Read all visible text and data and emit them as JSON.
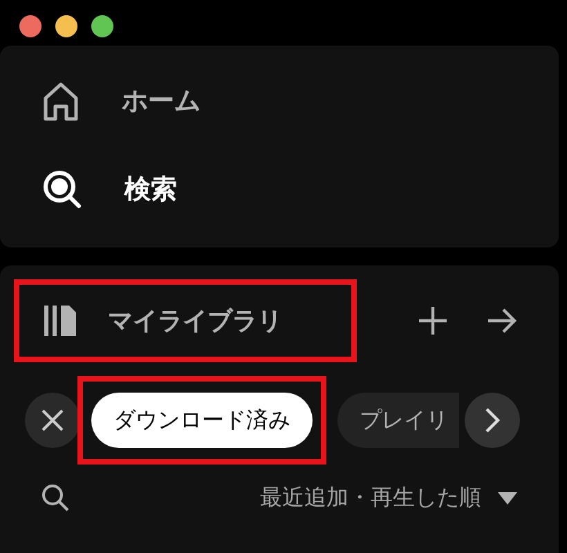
{
  "window": {
    "controls": [
      {
        "color": "#ed6a5e"
      },
      {
        "color": "#f5bf4f"
      },
      {
        "color": "#61c554"
      }
    ]
  },
  "nav": [
    {
      "kind": "home",
      "label": "ホーム",
      "selected": false
    },
    {
      "kind": "search",
      "label": "検索",
      "selected": true
    }
  ],
  "library": {
    "title": "マイライブラリ",
    "highlighted": true,
    "filters": [
      {
        "label": "ダウンロード済み",
        "selected": true,
        "highlighted": true
      },
      {
        "label": "プレイリ",
        "selected": false
      }
    ],
    "sort": {
      "label": "最近追加・再生した順"
    }
  }
}
